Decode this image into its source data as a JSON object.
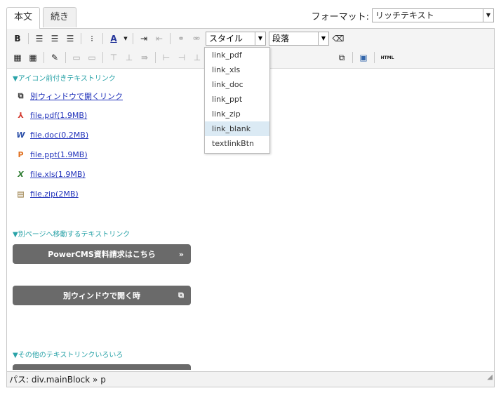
{
  "tabs": [
    "本文",
    "続き"
  ],
  "format": {
    "label": "フォーマット:",
    "value": "リッチテキスト"
  },
  "toolbar": {
    "bold": "B",
    "style_select": "スタイル",
    "block_select": "段落",
    "html_label": "HTML"
  },
  "style_menu": [
    "link_pdf",
    "link_xls",
    "link_doc",
    "link_ppt",
    "link_zip",
    "link_blank",
    "textlinkBtn"
  ],
  "sections": {
    "icon_links_title": "▼アイコン前付きテキストリンク",
    "page_links_title": "▼別ページへ移動するテキストリンク",
    "other_links_title": "▼その他のテキストリンクいろいろ"
  },
  "links": [
    {
      "icon": "window-icon",
      "glyph": "⧉",
      "color": "#333333",
      "text": "別ウィンドウで開くリンク"
    },
    {
      "icon": "pdf-icon",
      "glyph": "⅄",
      "color": "#d33a2f",
      "text": "file.pdf(1.9MB)"
    },
    {
      "icon": "word-icon",
      "glyph": "W",
      "color": "#2b4fa8",
      "text": "file.doc(0.2MB)"
    },
    {
      "icon": "powerpoint-icon",
      "glyph": "P",
      "color": "#e07020",
      "text": "file.ppt(1.9MB)"
    },
    {
      "icon": "excel-icon",
      "glyph": "X",
      "color": "#2f7d32",
      "text": "file.xls(1.9MB)"
    },
    {
      "icon": "zip-icon",
      "glyph": "▤",
      "color": "#8a6a2a",
      "text": "file.zip(2MB)"
    }
  ],
  "buttons": [
    {
      "text": "PowerCMS資料請求はこちら",
      "right": "»"
    },
    {
      "text": "別ウィンドウで開く時",
      "right": "⧉"
    }
  ],
  "status": {
    "path": "パス: div.mainBlock » p"
  }
}
